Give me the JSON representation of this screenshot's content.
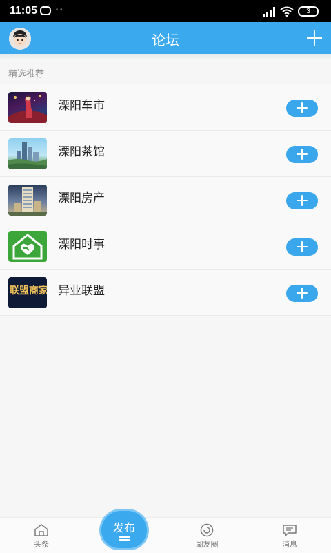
{
  "status_bar": {
    "time": "11:05",
    "battery": "3"
  },
  "nav": {
    "title": "论坛"
  },
  "section": {
    "title": "精选推荐"
  },
  "forums": [
    {
      "name": "溧阳车市",
      "icon": "car-market-thumbnail"
    },
    {
      "name": "溧阳茶馆",
      "icon": "teahouse-thumbnail"
    },
    {
      "name": "溧阳房产",
      "icon": "real-estate-thumbnail"
    },
    {
      "name": "溧阳时事",
      "icon": "current-affairs-thumbnail"
    },
    {
      "name": "异业联盟",
      "icon": "alliance-thumbnail",
      "thumb_text": "联盟商家"
    }
  ],
  "tabbar": {
    "tab1": "头条",
    "publish": "发布",
    "tab3": "湖友圈",
    "tab4": "消息"
  },
  "colors": {
    "accent": "#3ba9ee",
    "button": "#3aa7ec"
  }
}
